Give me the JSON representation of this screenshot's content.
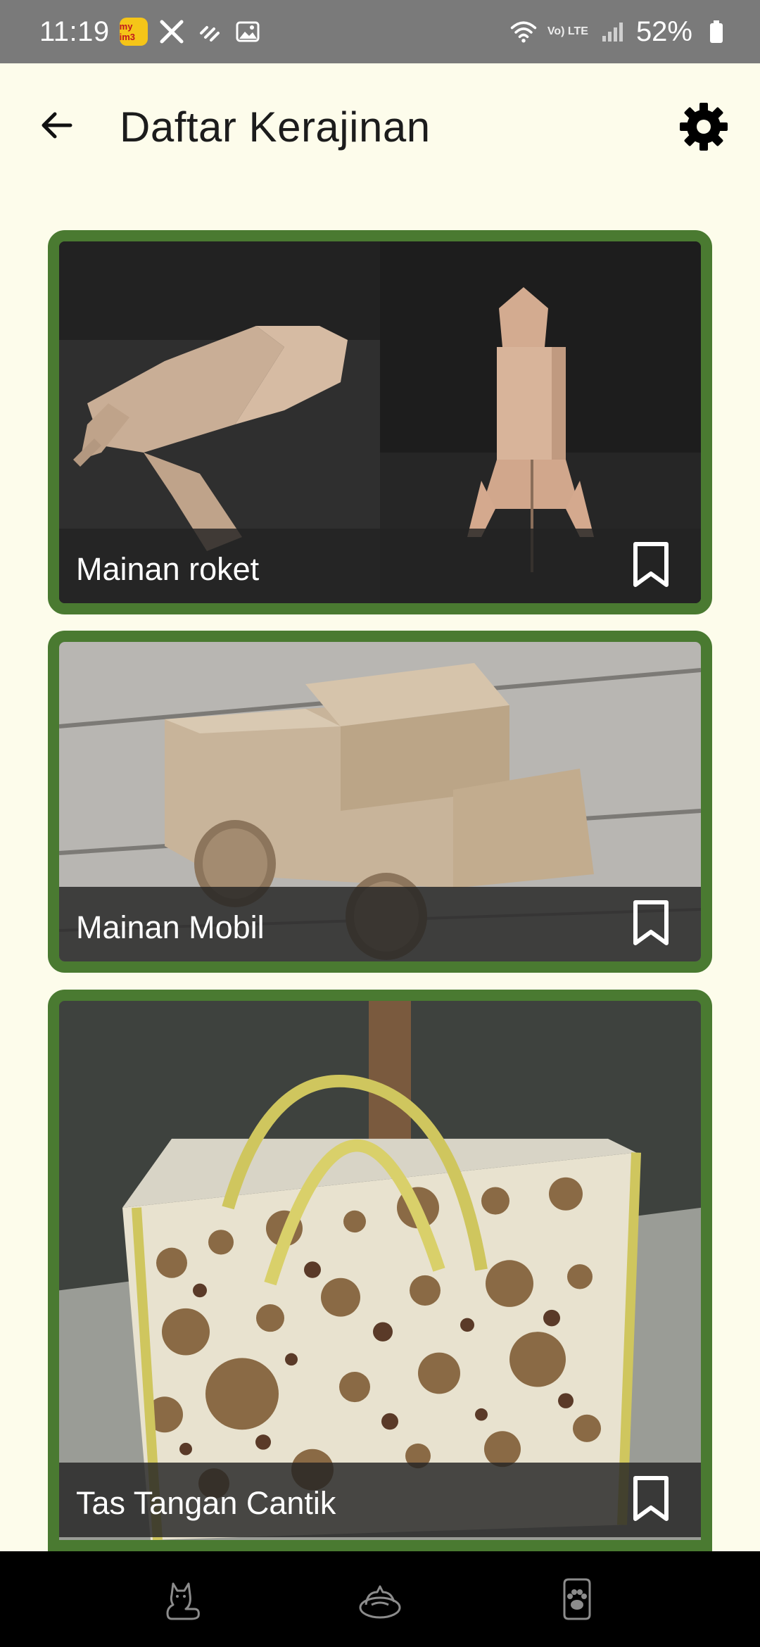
{
  "status_bar": {
    "time": "11:19",
    "app_badge": "my im3",
    "network_label": "Vo) LTE",
    "battery": "52%"
  },
  "app_bar": {
    "title": "Daftar Kerajinan",
    "back_icon": "arrow-left-icon",
    "settings_icon": "gear-icon"
  },
  "crafts": [
    {
      "title": "Mainan roket",
      "image": "cardboard-rocket-photo",
      "bookmarked": false
    },
    {
      "title": "Mainan Mobil",
      "image": "cardboard-car-photo",
      "bookmarked": false
    },
    {
      "title": "Tas Tangan Cantik",
      "image": "polka-dot-handbag-photo",
      "bookmarked": false
    }
  ],
  "bottom_nav": {
    "items": [
      {
        "icon": "cat-sitting-icon"
      },
      {
        "icon": "cat-in-bed-icon"
      },
      {
        "icon": "paw-tag-icon"
      }
    ]
  },
  "colors": {
    "background": "#FDFCEB",
    "card_border": "#4A7A31",
    "status_bar": "#7A7A7A",
    "bottom_nav": "#000000"
  }
}
